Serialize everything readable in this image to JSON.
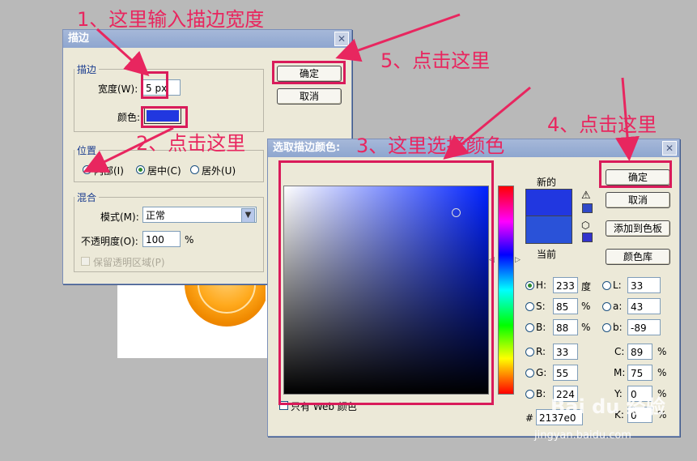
{
  "background": {
    "photo_desc": "orange"
  },
  "stroke_dialog": {
    "title": "描边",
    "group_stroke": "描边",
    "width_label": "宽度(W):",
    "width_value": "5 px",
    "color_label": "颜色:",
    "stroke_color": "#2137e0",
    "group_position": "位置",
    "pos_inside": "内部(I)",
    "pos_center": "居中(C)",
    "pos_outside": "居外(U)",
    "group_blend": "混合",
    "mode_label": "模式(M):",
    "mode_value": "正常",
    "opacity_label": "不透明度(O):",
    "opacity_value": "100",
    "opacity_unit": "%",
    "preserve_label": "保留透明区域(P)",
    "ok": "确定",
    "cancel": "取消"
  },
  "picker_dialog": {
    "title": "选取描边颜色:",
    "new_label": "新的",
    "current_label": "当前",
    "ok": "确定",
    "cancel": "取消",
    "add_swatch": "添加到色板",
    "libraries": "颜色库",
    "h_label": "H:",
    "h_value": "233",
    "h_unit": "度",
    "s_label": "S:",
    "s_value": "85",
    "s_unit": "%",
    "b_label": "B:",
    "b_value": "88",
    "b_unit": "%",
    "r_label": "R:",
    "r_value": "33",
    "g_label": "G:",
    "g_value": "55",
    "bl_label": "B:",
    "bl_value": "224",
    "l_label": "L:",
    "l_value": "33",
    "a_label": "a:",
    "a_value": "43",
    "lb_label": "b:",
    "lb_value": "-89",
    "c_label": "C:",
    "c_value": "89",
    "c_unit": "%",
    "m_label": "M:",
    "m_value": "75",
    "m_unit": "%",
    "y_label": "Y:",
    "y_value": "0",
    "y_unit": "%",
    "k_label": "K:",
    "k_value": "0",
    "k_unit": "%",
    "hex_label": "#",
    "hex_value": "2137e0",
    "web_only": "只有 Web 颜色",
    "new_color": "#2137e0",
    "current_color": "#2a52d8"
  },
  "annotations": {
    "step1": "1、这里输入描边宽度",
    "step2": "2、点击这里",
    "step3": "3、这里选择颜色",
    "step4": "4、点击这里",
    "step5": "5、点击这里",
    "color": "#e8265f"
  },
  "watermark": {
    "site": "jingyan.baidu.com",
    "brand": "Bai du 经验"
  }
}
